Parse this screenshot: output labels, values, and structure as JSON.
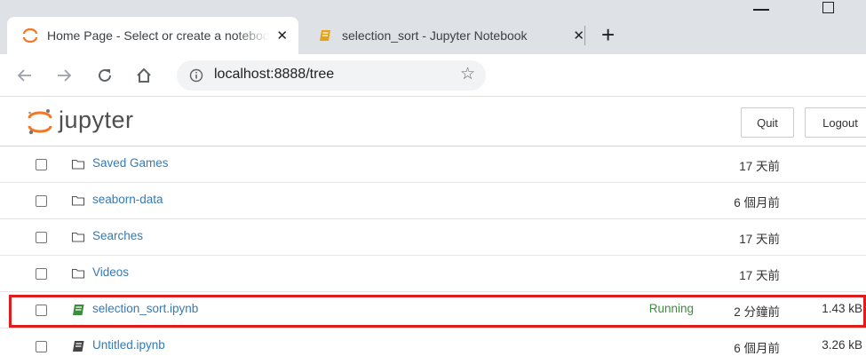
{
  "browser": {
    "tabs": [
      {
        "title": "Home Page - Select or create a notebook",
        "close_glyph": "✕",
        "active": true
      },
      {
        "title": "selection_sort - Jupyter Notebook",
        "close_glyph": "✕",
        "active": false
      }
    ],
    "new_tab_glyph": "+",
    "url": "localhost:8888/tree"
  },
  "header": {
    "logo_text": "jupyter",
    "quit_label": "Quit",
    "logout_label": "Logout"
  },
  "files": [
    {
      "type": "folder",
      "name": "Saved Games",
      "status": "",
      "modified": "17 天前",
      "size": ""
    },
    {
      "type": "folder",
      "name": "seaborn-data",
      "status": "",
      "modified": "6 個月前",
      "size": ""
    },
    {
      "type": "folder",
      "name": "Searches",
      "status": "",
      "modified": "17 天前",
      "size": ""
    },
    {
      "type": "folder",
      "name": "Videos",
      "status": "",
      "modified": "17 天前",
      "size": ""
    },
    {
      "type": "notebook",
      "name": "selection_sort.ipynb",
      "status": "Running",
      "modified": "2 分鐘前",
      "size": "1.43 kB",
      "running": true
    },
    {
      "type": "notebook",
      "name": "Untitled.ipynb",
      "status": "",
      "modified": "6 個月前",
      "size": "3.26 kB",
      "running": false
    }
  ],
  "colors": {
    "link": "#337ab7",
    "running": "#3c8d3c",
    "highlight_border": "#e01d1d",
    "jupyter_orange": "#f37726"
  }
}
